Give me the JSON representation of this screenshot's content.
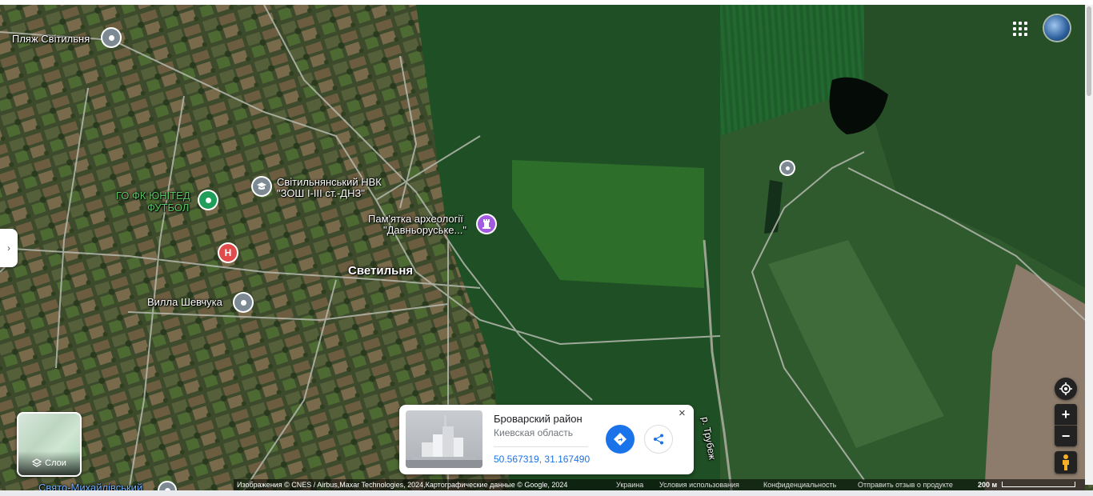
{
  "map": {
    "places": {
      "plyazh": "Пляж Світильня",
      "fk_line1": "ГО ФК ЮНІТЕД",
      "fk_line2": "ФУТБОЛ",
      "school_line1": "Світильнянський НВК",
      "school_line2": "\"ЗОШ І-ІІІ ст.-ДНЗ\"",
      "pamyatka_line1": "Пам'ятка археології",
      "pamyatka_line2": "\"Давньоруське...\"",
      "village": "Светильня",
      "villa": "Вилла Шевчука",
      "church": "Свято-Михайлівський",
      "river": "р. Трубеж"
    },
    "colors": {
      "pin_gray": "#7d8a93",
      "pin_green": "#1e9e5a",
      "pin_red": "#e24b4b",
      "pin_purple": "#a25be0"
    }
  },
  "layers_button": {
    "label": "Слои",
    "icon": "layers-icon"
  },
  "controls": {
    "location": "my-location-icon",
    "zoom_in": "+",
    "zoom_out": "−",
    "pegman": "pegman-icon"
  },
  "info_card": {
    "title": "Броварский район",
    "subtitle": "Киевская область",
    "coords": "50.567319, 31.167490",
    "close": "×"
  },
  "footer": {
    "attribution": "Изображения © CNES / Airbus,Maxar Technologies, 2024,Картографические данные © Google, 2024",
    "country": "Украина",
    "terms": "Условия использования",
    "privacy": "Конфиденциальность",
    "feedback": "Отправить отзыв о продукте",
    "scale": "200 м"
  }
}
